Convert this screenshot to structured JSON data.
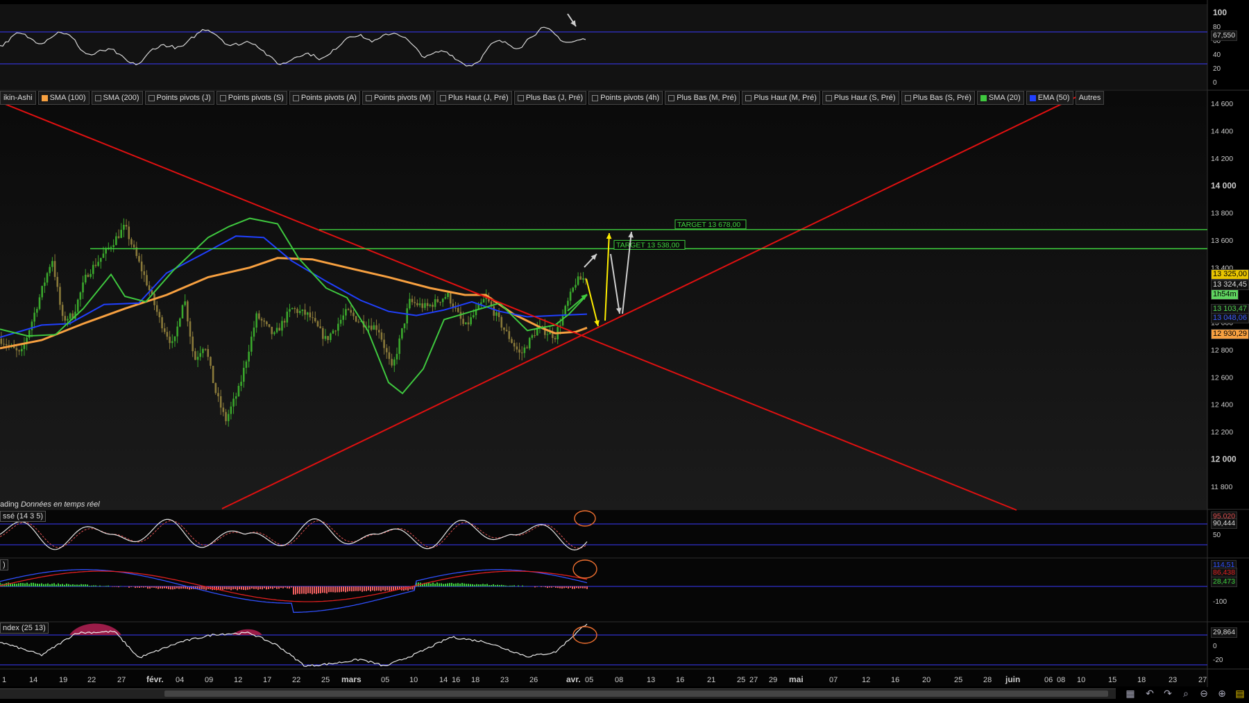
{
  "chart_data": {
    "type": "candlestick",
    "price_axis_ticks": [
      "14 600",
      "14 400",
      "14 200",
      "14 000",
      "13 800",
      "13 600",
      "13 400",
      "13 200",
      "13 000",
      "12 800",
      "12 600",
      "12 400",
      "12 200",
      "12 000",
      "11 800"
    ],
    "price_axis_bold": [
      "14 000",
      "12 000"
    ],
    "x_tick_labels": [
      "1",
      "14",
      "19",
      "22",
      "27",
      "févr.",
      "04",
      "09",
      "12",
      "17",
      "22",
      "25",
      "mars",
      "05",
      "10",
      "14",
      "16",
      "18",
      "23",
      "26",
      "avr.",
      "05",
      "08",
      "13",
      "16",
      "21",
      "25",
      "27",
      "29",
      "mai",
      "07",
      "12",
      "16",
      "20",
      "25",
      "28",
      "juin",
      "06",
      "08",
      "10",
      "15",
      "18",
      "23",
      "27"
    ],
    "x_tick_bold": [
      "févr.",
      "mars",
      "avr.",
      "mai",
      "juin"
    ],
    "price_tags": [
      {
        "text": "13 325,00",
        "bg": "#e8c400",
        "fg": "#000"
      },
      {
        "text": "13 324,45",
        "bg": "#111",
        "fg": "#ddd"
      },
      {
        "text": "1h54m",
        "bg": "#5fd35f",
        "fg": "#000"
      },
      {
        "text": "13 103,47",
        "bg": "#111",
        "fg": "#4fd34f"
      },
      {
        "text": "13 048,06",
        "bg": "#111",
        "fg": "#3c5cff"
      },
      {
        "text": "12 930,29",
        "bg": "#f7a040",
        "fg": "#000"
      }
    ],
    "targets": [
      {
        "label": "TARGET 13 678,00",
        "value": 13678
      },
      {
        "label": "TARGET 13 538,00",
        "value": 13538
      }
    ],
    "legend": [
      {
        "label": "ikin-Ashi",
        "color": ""
      },
      {
        "label": "SMA (100)",
        "color": "#f7a040"
      },
      {
        "label": "SMA (200)",
        "color": ""
      },
      {
        "label": "Points pivots (J)",
        "color": ""
      },
      {
        "label": "Points pivots (S)",
        "color": ""
      },
      {
        "label": "Points pivots (A)",
        "color": ""
      },
      {
        "label": "Points pivots (M)",
        "color": ""
      },
      {
        "label": "Plus Haut (J, Pré)",
        "color": ""
      },
      {
        "label": "Plus Bas (J, Pré)",
        "color": ""
      },
      {
        "label": "Points pivots (4h)",
        "color": ""
      },
      {
        "label": "Plus Bas (M, Pré)",
        "color": ""
      },
      {
        "label": "Plus Haut (M, Pré)",
        "color": ""
      },
      {
        "label": "Plus Haut (S, Pré)",
        "color": ""
      },
      {
        "label": "Plus Bas (S, Pré)",
        "color": ""
      },
      {
        "label": "SMA (20)",
        "color": "#3fc93f"
      },
      {
        "label": "EMA (50)",
        "color": "#2040ff"
      },
      {
        "label": "Autres",
        "color": ""
      }
    ],
    "rsi_panel": {
      "ticks": [
        "100",
        "80",
        "60",
        "40",
        "20",
        "0"
      ],
      "value_tag": "67,550"
    },
    "stoch_panel": {
      "label": "ssé (14 3 5)",
      "tags": [
        "95,020",
        "90,444"
      ],
      "ticks": [
        "50"
      ]
    },
    "macd_panel": {
      "label": ")",
      "tags": [
        "114,51",
        "86,438",
        "28,473"
      ],
      "ticks": [
        "-100"
      ]
    },
    "index_panel": {
      "label": "ndex (25 13)",
      "tags": [
        "29,864"
      ],
      "ticks": [
        "20",
        "0",
        "-20"
      ]
    },
    "realtime_text": {
      "prefix": "ading",
      "italic": "Données en temps réel"
    }
  }
}
